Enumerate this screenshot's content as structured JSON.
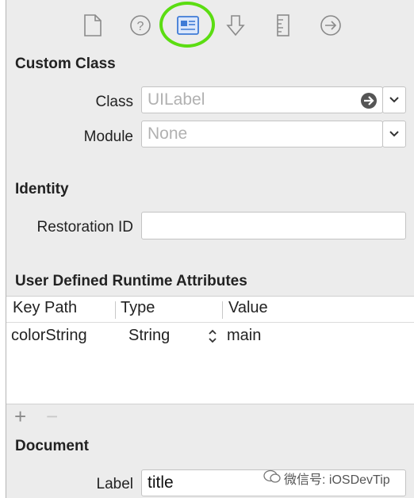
{
  "toolbar": {
    "icons": [
      "file-inspector-icon",
      "quick-help-icon",
      "identity-inspector-icon",
      "attributes-inspector-icon",
      "size-inspector-icon",
      "connections-inspector-icon"
    ],
    "highlight_color": "#5bdd12",
    "selected_color": "#3f7bd6"
  },
  "custom_class": {
    "title": "Custom Class",
    "class_label": "Class",
    "class_placeholder": "UILabel",
    "module_label": "Module",
    "module_placeholder": "None"
  },
  "identity": {
    "title": "Identity",
    "restoration_label": "Restoration ID",
    "restoration_value": ""
  },
  "runtime_attributes": {
    "title": "User Defined Runtime Attributes",
    "columns": [
      "Key Path",
      "Type",
      "Value"
    ],
    "rows": [
      {
        "key_path": "colorString",
        "type": "String",
        "value": "main"
      }
    ],
    "add_label": "+",
    "remove_label": "−"
  },
  "document": {
    "title": "Document",
    "label_label": "Label",
    "label_value": "title"
  },
  "watermark": {
    "text": "微信号: iOSDevTip"
  }
}
